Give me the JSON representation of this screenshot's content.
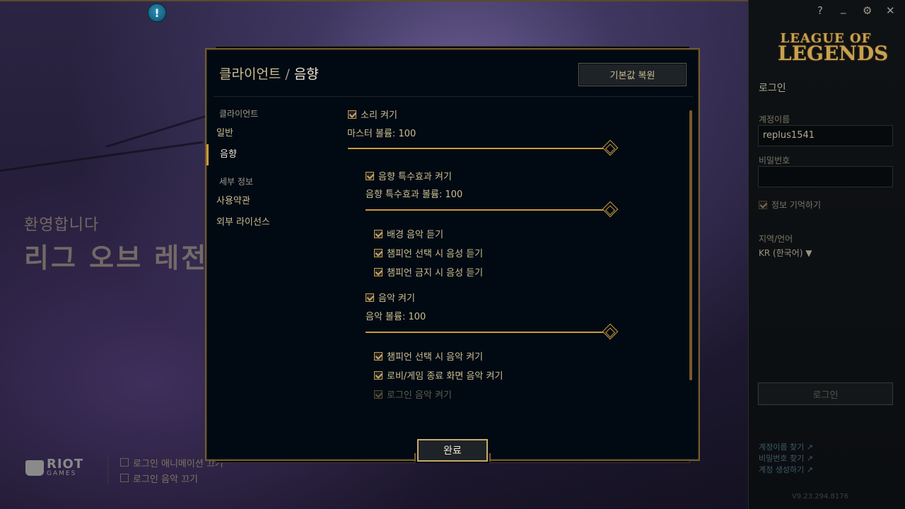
{
  "background": {
    "welcome_small": "환영합니다",
    "welcome_big": "리그 오브 레전드",
    "riot_brand_top": "RIOT",
    "riot_brand_bottom": "GAMES",
    "bottom_options": [
      "로그인 애니메이션 끄기",
      "로그인 음악 끄기"
    ],
    "alert_glyph": "!"
  },
  "window_controls": {
    "help": "?",
    "minimize": "_",
    "settings": "⚙",
    "close": "✕"
  },
  "right_panel": {
    "logo_line1": "LEAGUE OF",
    "logo_line2": "LEGENDS",
    "title": "로그인",
    "username_label": "계정이름",
    "username_value": "replus1541",
    "password_label": "비밀번호",
    "password_value": "",
    "remember_label": "정보 기억하기",
    "region_label": "지역/언어",
    "region_value": "KR (한국어)",
    "login_button": "로그인",
    "links": [
      "계정이름 찾기 ↗",
      "비밀번호 찾기 ↗",
      "계정 생성하기 ↗"
    ],
    "version": "V9.23.294.8176"
  },
  "modal": {
    "breadcrumb_parent": "클라이언트",
    "breadcrumb_sep": "/",
    "breadcrumb_current": "음향",
    "restore_button": "기본값 복원",
    "done_button": "완료",
    "nav": {
      "section_client": "클라이언트",
      "item_general": "일반",
      "item_sound": "음향",
      "section_details": "세부 정보",
      "item_terms": "사용약관",
      "item_licenses": "외부 라이선스"
    },
    "settings": {
      "sound_on": "소리 켜기",
      "master_volume": "마스터 볼륨: 100",
      "sfx_on": "음향 특수효과 켜기",
      "sfx_volume": "음향 특수효과 볼륨: 100",
      "ambient": "배경 음악 듣기",
      "champ_select_voice": "챔피언 선택 시 음성 듣기",
      "champ_ban_voice": "챔피언 금지 시 음성 듣기",
      "music_on": "음악 켜기",
      "music_volume": "음악 볼륨: 100",
      "champ_select_music": "챔피언 선택 시 음악 켜기",
      "lobby_end_music": "로비/게임 종료 화면 음악 켜기",
      "login_music": "로그인 음악 켜기"
    },
    "slider_levels": {
      "master": 1.0,
      "sfx": 1.0,
      "music": 1.0
    },
    "colors": {
      "gold": "#c89b3c",
      "gold_light": "#c8aa6e",
      "panel_bg": "#010a13"
    }
  }
}
